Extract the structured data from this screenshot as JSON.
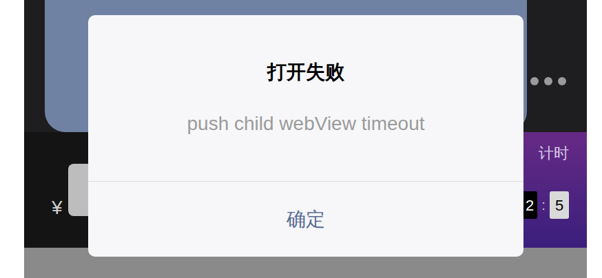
{
  "page": {
    "price_symbol": "¥",
    "countdown_label": "计时",
    "countdown": [
      "2",
      ":",
      "5"
    ]
  },
  "dialog": {
    "title": "打开失败",
    "message": "push child webView timeout",
    "buttons": [
      "确定"
    ]
  }
}
